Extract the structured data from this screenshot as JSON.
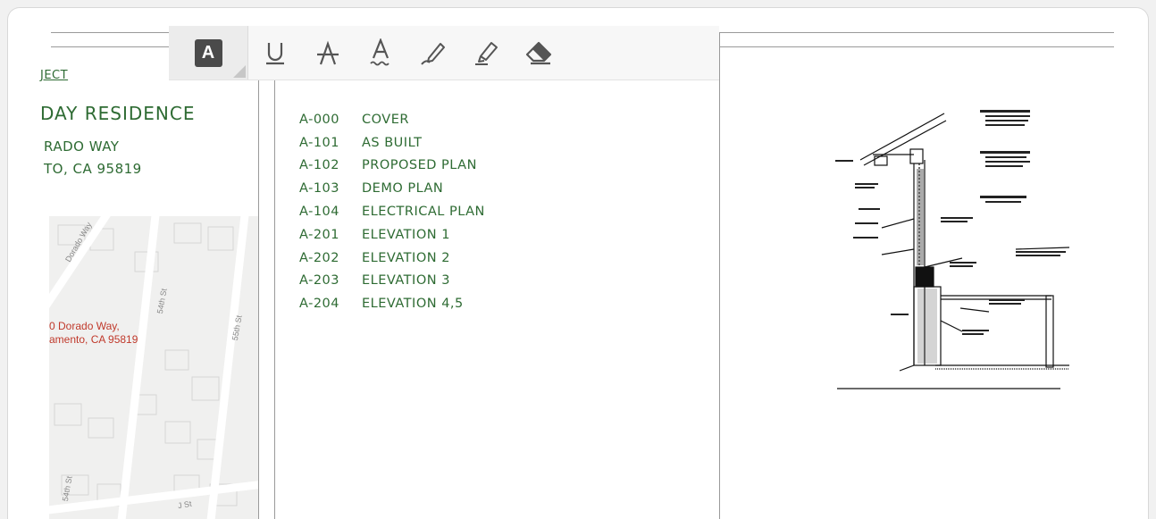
{
  "toolbar": {
    "tools": [
      {
        "name": "text-tool",
        "glyph": "A"
      },
      {
        "name": "underline-tool"
      },
      {
        "name": "strikethrough-tool"
      },
      {
        "name": "squiggly-tool"
      },
      {
        "name": "pen-tool"
      },
      {
        "name": "highlighter-tool"
      },
      {
        "name": "eraser-tool"
      }
    ]
  },
  "project": {
    "link_text": "JECT",
    "title": "DAY RESIDENCE",
    "address_line1": "RADO WAY",
    "address_line2": "TO, CA 95819"
  },
  "map": {
    "label_line1": "0 Dorado Way,",
    "label_line2": "amento, CA 95819",
    "streets": [
      "Dorado Way",
      "54th St",
      "55th St",
      "54th St",
      "J St"
    ]
  },
  "sheets": [
    {
      "number": "A-000",
      "title": "COVER"
    },
    {
      "number": "A-101",
      "title": "AS BUILT"
    },
    {
      "number": "A-102",
      "title": "PROPOSED PLAN"
    },
    {
      "number": "A-103",
      "title": "DEMO PLAN"
    },
    {
      "number": "A-104",
      "title": "ELECTRICAL PLAN"
    },
    {
      "number": "A-201",
      "title": "ELEVATION 1"
    },
    {
      "number": "A-202",
      "title": "ELEVATION 2"
    },
    {
      "number": "A-203",
      "title": "ELEVATION 3"
    },
    {
      "number": "A-204",
      "title": "ELEVATION 4,5"
    }
  ],
  "colors": {
    "handwriting": "#2e6b33",
    "map_label": "#c0392b",
    "toolbar_icon": "#555555"
  }
}
